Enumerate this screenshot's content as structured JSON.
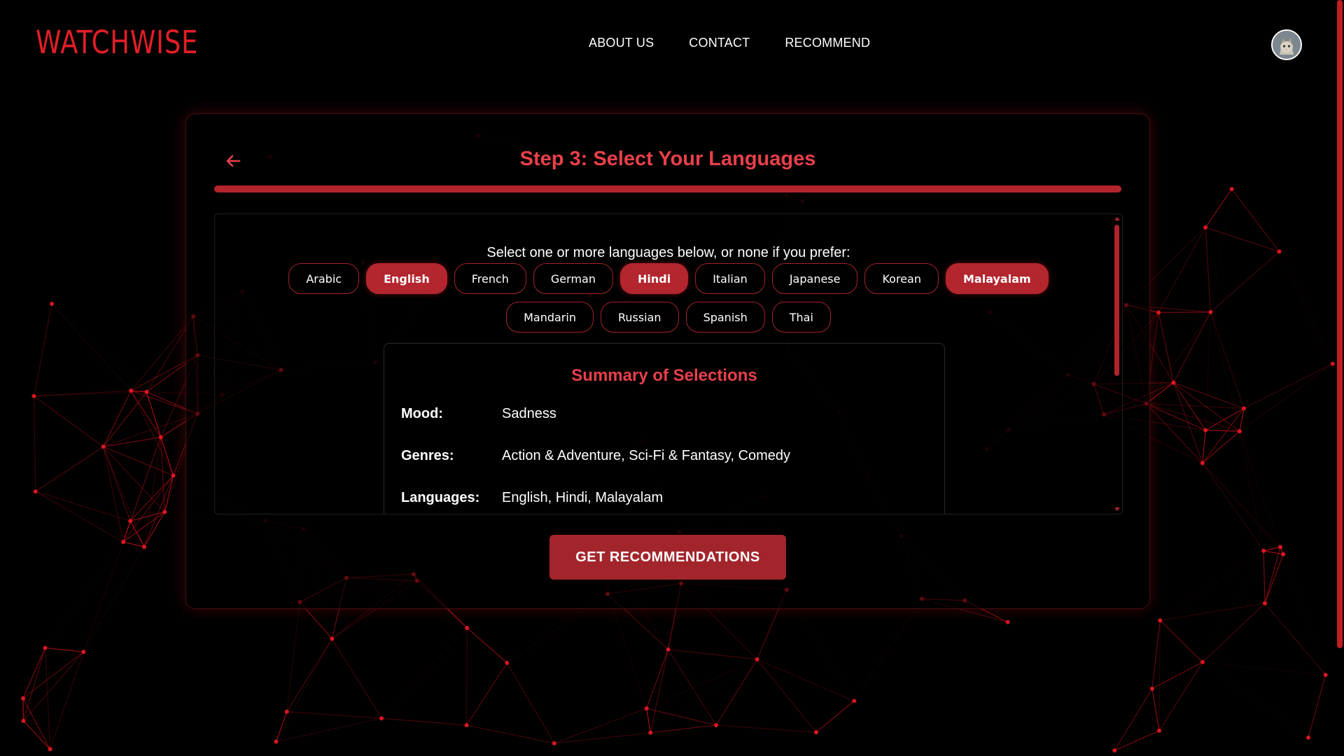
{
  "brand": {
    "logo_text": "WATCHWISE",
    "accent_color": "#e21e26"
  },
  "nav": {
    "links": [
      {
        "label": "ABOUT US"
      },
      {
        "label": "CONTACT"
      },
      {
        "label": "RECOMMEND"
      }
    ],
    "avatar_icon": "user-avatar-cat-icon"
  },
  "wizard": {
    "back_icon": "arrow-left-icon",
    "title": "Step 3: Select Your Languages",
    "progress_percent": 100,
    "instruction": "Select one or more languages below, or none if you prefer:",
    "languages": [
      {
        "label": "Arabic",
        "selected": false
      },
      {
        "label": "English",
        "selected": true
      },
      {
        "label": "French",
        "selected": false
      },
      {
        "label": "German",
        "selected": false
      },
      {
        "label": "Hindi",
        "selected": true
      },
      {
        "label": "Italian",
        "selected": false
      },
      {
        "label": "Japanese",
        "selected": false
      },
      {
        "label": "Korean",
        "selected": false
      },
      {
        "label": "Malayalam",
        "selected": true
      },
      {
        "label": "Mandarin",
        "selected": false
      },
      {
        "label": "Russian",
        "selected": false
      },
      {
        "label": "Spanish",
        "selected": false
      },
      {
        "label": "Thai",
        "selected": false
      }
    ],
    "summary": {
      "title": "Summary of Selections",
      "rows": [
        {
          "key": "Mood:",
          "value": "Sadness"
        },
        {
          "key": "Genres:",
          "value": "Action & Adventure, Sci-Fi & Fantasy, Comedy"
        },
        {
          "key": "Languages:",
          "value": "English, Hindi, Malayalam"
        }
      ]
    },
    "cta_label": "GET RECOMMENDATIONS"
  },
  "colors": {
    "title_red": "#e8404a",
    "chip_selected": "#b3262e",
    "button_red": "#a3252c",
    "background": "#000000"
  }
}
